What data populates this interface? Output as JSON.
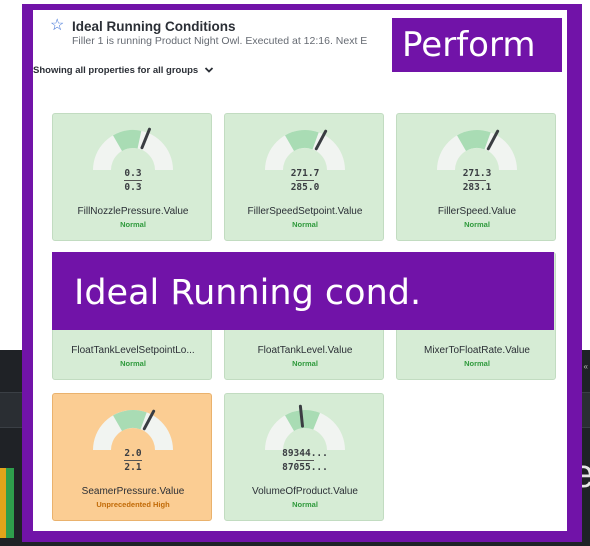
{
  "header": {
    "title": "Ideal Running Conditions",
    "subtitle": "Filler 1 is running Product Night Owl. Executed at 12:16. Next E",
    "groups_label": "Showing all properties for all groups"
  },
  "overlays": {
    "perform": "Perform",
    "ideal": "Ideal Running cond."
  },
  "tiles": [
    {
      "value": "0.3",
      "target": "0.3",
      "name": "FillNozzlePressure.Value",
      "status": "Normal",
      "state": "normal"
    },
    {
      "value": "271.7",
      "target": "285.0",
      "name": "FillerSpeedSetpoint.Value",
      "status": "Normal",
      "state": "normal"
    },
    {
      "value": "271.3",
      "target": "283.1",
      "name": "FillerSpeed.Value",
      "status": "Normal",
      "state": "normal"
    },
    {
      "value": "",
      "target": "",
      "name": "FloatTankLevelSetpointLo...",
      "status": "Normal",
      "state": "normal"
    },
    {
      "value": "",
      "target": "",
      "name": "FloatTankLevel.Value",
      "status": "Normal",
      "state": "normal"
    },
    {
      "value": "",
      "target": "",
      "name": "MixerToFloatRate.Value",
      "status": "Normal",
      "state": "normal"
    },
    {
      "value": "2.0",
      "target": "2.1",
      "name": "SeamerPressure.Value",
      "status": "Unprecedented High",
      "state": "warning"
    },
    {
      "value": "89344...",
      "target": "87055...",
      "name": "VolumeOfProduct.Value",
      "status": "Normal",
      "state": "normal"
    }
  ],
  "background": {
    "right_letter": "e",
    "right_glyph": "«"
  },
  "colors": {
    "overlay_purple": "#7113a8",
    "tile_normal": "#d6ecd5",
    "tile_warning": "#fbcd93",
    "status_normal": "#2f9a3c",
    "status_warning": "#c16a07",
    "gauge_band": "#a9dcb4"
  },
  "icons": {
    "favorite": "star-outline-icon",
    "expand": "chevron-down-icon"
  }
}
